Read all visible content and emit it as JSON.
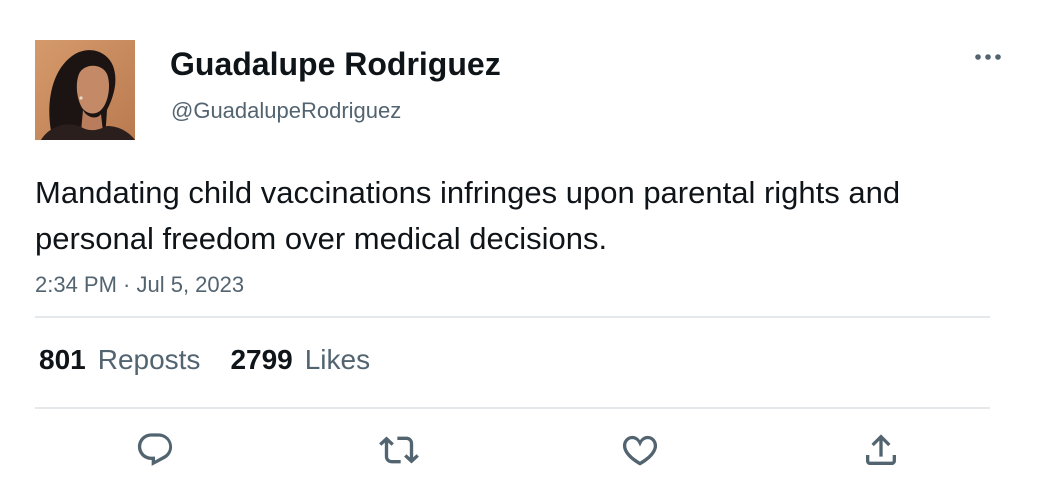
{
  "tweet": {
    "author": {
      "display_name": "Guadalupe Rodriguez",
      "handle": "@GuadalupeRodriguez",
      "avatar": "profile-photo"
    },
    "text": "Mandating child vaccinations infringes upon parental rights and personal freedom over medical decisions.",
    "timestamp": "2:34 PM · Jul 5, 2023",
    "stats": {
      "reposts_count": "801",
      "reposts_label": "Reposts",
      "likes_count": "2799",
      "likes_label": "Likes"
    },
    "icons": {
      "more": "more-dots-icon",
      "reply": "reply-icon",
      "repost": "repost-icon",
      "like": "heart-icon",
      "share": "share-icon"
    },
    "colors": {
      "text_primary": "#0f1419",
      "text_secondary": "#536471",
      "divider": "#e6e9ec"
    }
  }
}
